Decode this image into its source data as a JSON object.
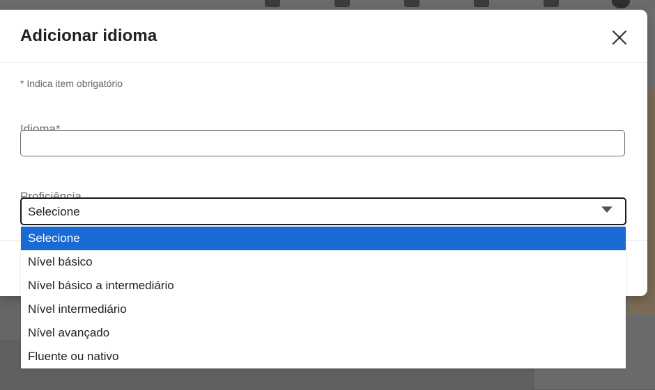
{
  "modal": {
    "title": "Adicionar idioma",
    "close_icon": "close-icon",
    "required_note": "* Indica item obrigatório"
  },
  "form": {
    "idioma": {
      "label": "Idioma*",
      "value": "",
      "placeholder": ""
    },
    "proficiencia": {
      "label": "Proficiência",
      "selected_value": "Selecione",
      "arrow_icon": "caret-down-icon",
      "options": [
        "Selecione",
        "Nível básico",
        "Nível básico a intermediário",
        "Nível intermediário",
        "Nível avançado",
        "Fluente ou nativo"
      ],
      "highlighted_option": "Selecione"
    }
  },
  "colors": {
    "highlight": "#1a6ad6",
    "text": "#1f1f1f",
    "label": "#6e6e6e",
    "overlay": "#6a6a6a"
  }
}
